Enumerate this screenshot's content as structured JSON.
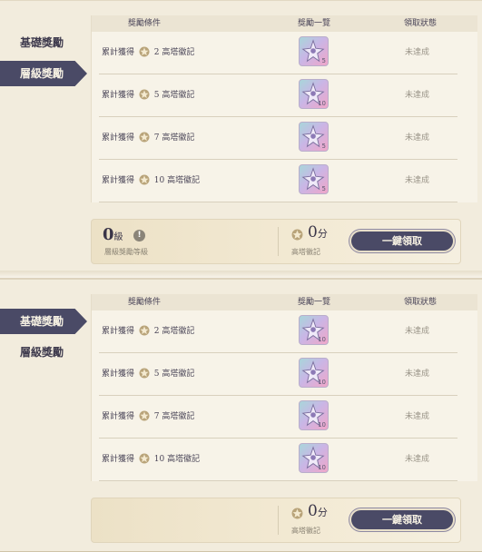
{
  "panel1": {
    "sidebar": [
      {
        "label": "基礎獎勵",
        "active": false
      },
      {
        "label": "層級獎勵",
        "active": true
      }
    ],
    "header": {
      "col1": "獎勵條件",
      "col2": "獎勵一覽",
      "col3": "領取狀態"
    },
    "rows": [
      {
        "prefix": "累計獲得",
        "count": "2",
        "item": "高塔徽記",
        "qty": "5",
        "status": "未達成"
      },
      {
        "prefix": "累計獲得",
        "count": "5",
        "item": "高塔徽記",
        "qty": "10",
        "status": "未達成"
      },
      {
        "prefix": "累計獲得",
        "count": "7",
        "item": "高塔徽記",
        "qty": "5",
        "status": "未達成"
      },
      {
        "prefix": "累計獲得",
        "count": "10",
        "item": "高塔徽記",
        "qty": "5",
        "status": "未達成"
      }
    ],
    "footer": {
      "level_value": "0",
      "level_unit": "級",
      "level_label": "層級獎勵等級",
      "points_value": "0",
      "points_unit": "分",
      "points_label": "高塔徽記",
      "claim_label": "一鍵領取"
    }
  },
  "panel2": {
    "sidebar": [
      {
        "label": "基礎獎勵",
        "active": true
      },
      {
        "label": "層級獎勵",
        "active": false
      }
    ],
    "header": {
      "col1": "獎勵條件",
      "col2": "獎勵一覽",
      "col3": "領取狀態"
    },
    "rows": [
      {
        "prefix": "累計獲得",
        "count": "2",
        "item": "高塔徽記",
        "qty": "10",
        "status": "未達成"
      },
      {
        "prefix": "累計獲得",
        "count": "5",
        "item": "高塔徽記",
        "qty": "10",
        "status": "未達成"
      },
      {
        "prefix": "累計獲得",
        "count": "7",
        "item": "高塔徽記",
        "qty": "10",
        "status": "未達成"
      },
      {
        "prefix": "累計獲得",
        "count": "10",
        "item": "高塔徽記",
        "qty": "10",
        "status": "未達成"
      }
    ],
    "footer": {
      "points_value": "0",
      "points_unit": "分",
      "points_label": "高塔徽記",
      "claim_label": "一鍵領取"
    }
  },
  "colors": {
    "accent": "#4a4a66",
    "background": "#f2ecdd",
    "status_text": "#9a9488"
  },
  "icons": [
    "tower-medal-icon",
    "reward-star-icon",
    "info-icon"
  ]
}
